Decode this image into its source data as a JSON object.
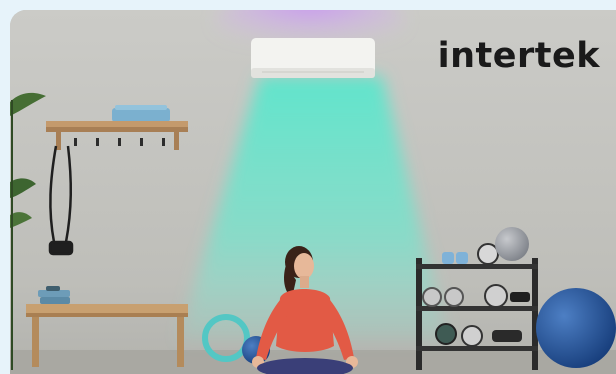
{
  "brand": {
    "logo_text": "intertek"
  },
  "colors": {
    "page_background": "#e7f3fa",
    "wall": "#c4c4c0",
    "airflow": "#62e7cd",
    "uv_glow": "#c79bf0",
    "top_wear": "#e25a45"
  }
}
